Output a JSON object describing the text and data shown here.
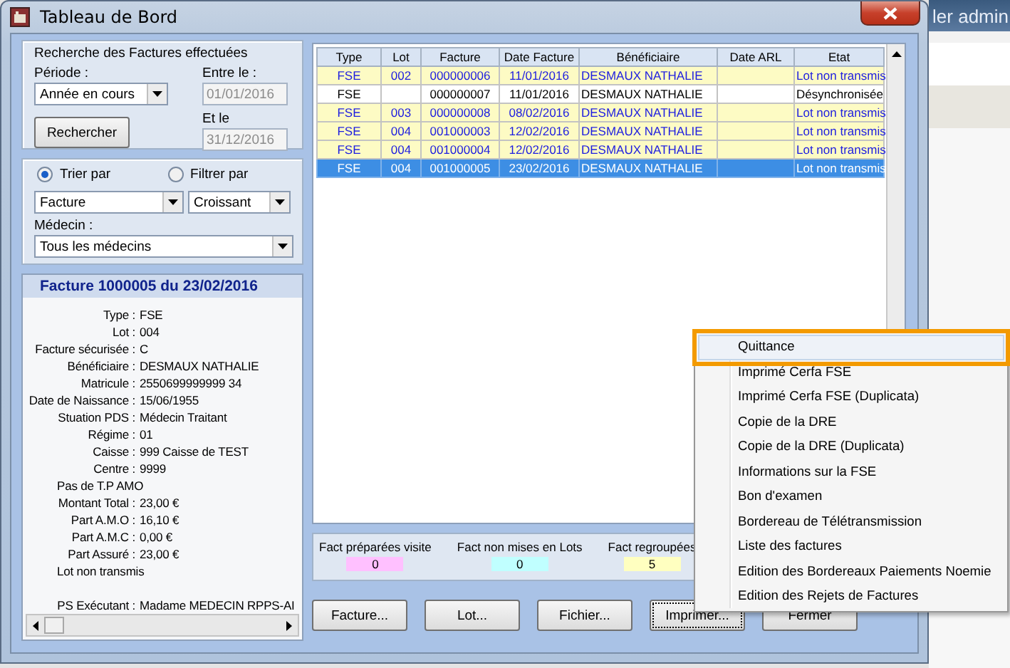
{
  "background": {
    "text": "ler admin"
  },
  "window": {
    "title": "Tableau de Bord"
  },
  "search": {
    "title": "Recherche des Factures effectuées",
    "period_label": "Période :",
    "period_value": "Année en cours",
    "from_label": "Entre le :",
    "from_value": "01/01/2016",
    "from_disabled": true,
    "to_label": "Et le",
    "to_value": "31/12/2016",
    "to_disabled": true,
    "button": "Rechercher"
  },
  "sorting": {
    "options": [
      {
        "label": "Trier par",
        "selected": true
      },
      {
        "label": "Filtrer par",
        "selected": false
      }
    ],
    "field_value": "Facture",
    "order_value": "Croissant",
    "doctor_label": "Médecin :",
    "doctor_value": "Tous les médecins"
  },
  "details": {
    "title": "Facture 1000005  du 23/02/2016",
    "lines": [
      {
        "kind": "field",
        "label": "Type :",
        "value": "FSE"
      },
      {
        "kind": "field",
        "label": "Lot :",
        "value": "004"
      },
      {
        "kind": "field",
        "label": "Facture sécurisée :",
        "value": "C"
      },
      {
        "kind": "field",
        "label": "Bénéficiaire :",
        "value": "DESMAUX NATHALIE"
      },
      {
        "kind": "field",
        "label": "Matricule :",
        "value": "2550699999999 34"
      },
      {
        "kind": "field",
        "label": "Date de Naissance :",
        "value": "15/06/1955"
      },
      {
        "kind": "field",
        "label": "Stuation PDS :",
        "value": "Médecin Traitant"
      },
      {
        "kind": "field",
        "label": "Régime :",
        "value": "01"
      },
      {
        "kind": "field",
        "label": "Caisse :",
        "value": "999 Caisse de TEST"
      },
      {
        "kind": "field",
        "label": "Centre :",
        "value": "9999"
      },
      {
        "kind": "note",
        "label": "Pas de T.P AMO"
      },
      {
        "kind": "field",
        "label": "Montant Total :",
        "value": "23,00 €"
      },
      {
        "kind": "field",
        "label": "Part A.M.O :",
        "value": "16,10 €"
      },
      {
        "kind": "field",
        "label": "Part A.M.C :",
        "value": "0,00 €"
      },
      {
        "kind": "field",
        "label": "Part Assuré :",
        "value": "23,00 €"
      },
      {
        "kind": "note",
        "label": "Lot non transmis"
      },
      {
        "kind": "gap"
      },
      {
        "kind": "field",
        "label": "PS Exécutant :",
        "value": "Madame MEDECIN RPPS-AI"
      }
    ]
  },
  "table": {
    "columns": [
      "Type",
      "Lot",
      "Facture",
      "Date Facture",
      "Bénéficiaire",
      "Date ARL",
      "Etat"
    ],
    "rows": [
      {
        "kind": "pending",
        "selected": false,
        "cells": [
          "FSE",
          "002",
          "000000006",
          "11/01/2016",
          "DESMAUX NATHALIE",
          "",
          "Lot non transmis"
        ]
      },
      {
        "kind": "plain",
        "selected": false,
        "cells": [
          "FSE",
          "",
          "000000007",
          "11/01/2016",
          "DESMAUX NATHALIE",
          "",
          "Désynchronisée"
        ]
      },
      {
        "kind": "pending",
        "selected": false,
        "cells": [
          "FSE",
          "003",
          "000000008",
          "08/02/2016",
          "DESMAUX NATHALIE",
          "",
          "Lot non transmis"
        ]
      },
      {
        "kind": "pending",
        "selected": false,
        "cells": [
          "FSE",
          "004",
          "001000003",
          "12/02/2016",
          "DESMAUX NATHALIE",
          "",
          "Lot non transmis"
        ]
      },
      {
        "kind": "pending",
        "selected": false,
        "cells": [
          "FSE",
          "004",
          "001000004",
          "12/02/2016",
          "DESMAUX NATHALIE",
          "",
          "Lot non transmis"
        ]
      },
      {
        "kind": "pending",
        "selected": true,
        "cells": [
          "FSE",
          "004",
          "001000005",
          "23/02/2016",
          "DESMAUX NATHALIE",
          "",
          "Lot non transmis"
        ]
      }
    ]
  },
  "counters": [
    {
      "label": "Fact préparées visite",
      "value": "0",
      "color": "#ffc0ff"
    },
    {
      "label": "Fact non mises en Lots",
      "value": "0",
      "color": "#c0ffff"
    },
    {
      "label": "Fact regroupées",
      "value": "5",
      "color": "#ffffc0"
    }
  ],
  "buttons": [
    {
      "label": "Facture...",
      "focused": false
    },
    {
      "label": "Lot...",
      "focused": false
    },
    {
      "label": "Fichier...",
      "focused": false
    },
    {
      "label": "Imprimer...",
      "focused": true
    },
    {
      "label": "Fermer",
      "focused": false
    }
  ],
  "menu": {
    "items": [
      {
        "label": "Quittance",
        "selected": true
      },
      {
        "label": "Imprimé Cerfa FSE",
        "selected": false
      },
      {
        "label": "Imprimé Cerfa FSE (Duplicata)",
        "selected": false
      },
      {
        "label": "Copie de la DRE",
        "selected": false
      },
      {
        "label": "Copie de la DRE (Duplicata)",
        "selected": false
      },
      {
        "label": "Informations sur la FSE",
        "selected": false
      },
      {
        "label": "Bon d'examen",
        "selected": false
      },
      {
        "label": "Bordereau de Télétransmission",
        "selected": false
      },
      {
        "label": "Liste des factures",
        "selected": false
      },
      {
        "label": "Edition des Bordereaux Paiements Noemie",
        "selected": false
      },
      {
        "label": "Edition des Rejets de Factures",
        "selected": false
      }
    ]
  }
}
